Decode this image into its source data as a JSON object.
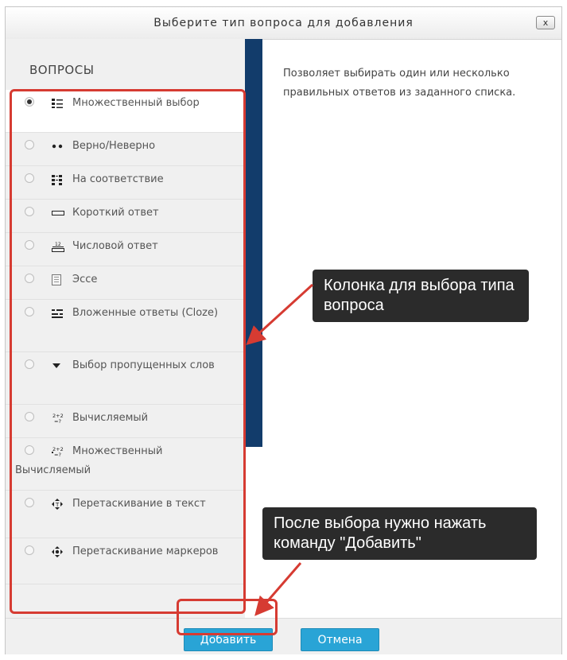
{
  "dialog": {
    "title": "Выберите тип вопроса для добавления",
    "close_label": "x"
  },
  "left": {
    "heading": "ВОПРОСЫ",
    "items": [
      {
        "label": "Множественный выбор",
        "icon": "multichoice-icon",
        "selected": true
      },
      {
        "label": "Верно/Неверно",
        "icon": "truefalse-icon",
        "selected": false
      },
      {
        "label": "На соответствие",
        "icon": "match-icon",
        "selected": false
      },
      {
        "label": "Короткий ответ",
        "icon": "shortanswer-icon",
        "selected": false
      },
      {
        "label": "Числовой ответ",
        "icon": "numerical-icon",
        "selected": false
      },
      {
        "label": "Эссе",
        "icon": "essay-icon",
        "selected": false
      },
      {
        "label": "Вложенные ответы (Cloze)",
        "icon": "cloze-icon",
        "selected": false
      },
      {
        "label": "Выбор пропущенных слов",
        "icon": "gapselect-icon",
        "selected": false
      },
      {
        "label": "Вычисляемый",
        "icon": "calculated-icon",
        "selected": false
      },
      {
        "label": "Множественный Вычисляемый",
        "icon": "calcmulti-icon",
        "selected": false
      },
      {
        "label": "Перетаскивание в текст",
        "icon": "ddwtos-icon",
        "selected": false
      },
      {
        "label": "Перетаскивание маркеров",
        "icon": "ddmarker-icon",
        "selected": false
      }
    ]
  },
  "description": "Позволяет выбирать один или несколько правильных ответов из заданного списка.",
  "footer": {
    "add_label": "Добавить",
    "cancel_label": "Отмена"
  },
  "annotations": {
    "callout_column": "Колонка для выбора типа вопроса",
    "callout_add": "После выбора нужно нажать команду \"Добавить\""
  },
  "colors": {
    "accent_blue": "#29a4d6",
    "sidebar_bar": "#123c6b",
    "annotation_red": "#d63b32",
    "callout_bg": "#2b2b2b"
  }
}
